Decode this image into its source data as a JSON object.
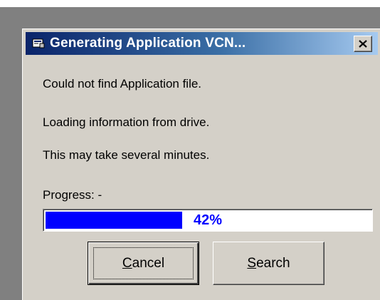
{
  "window": {
    "title": "Generating Application VCN...",
    "close_label": "✕"
  },
  "messages": {
    "line1": "Could not find Application file.",
    "line2": "Loading information from drive.",
    "line3": "This may take several minutes."
  },
  "progress": {
    "label": "Progress: -",
    "text": "42%",
    "fraction": 0.42,
    "fill_color": "#0000ff"
  },
  "buttons": {
    "cancel_label": "Cancel",
    "search_label": "Search"
  }
}
